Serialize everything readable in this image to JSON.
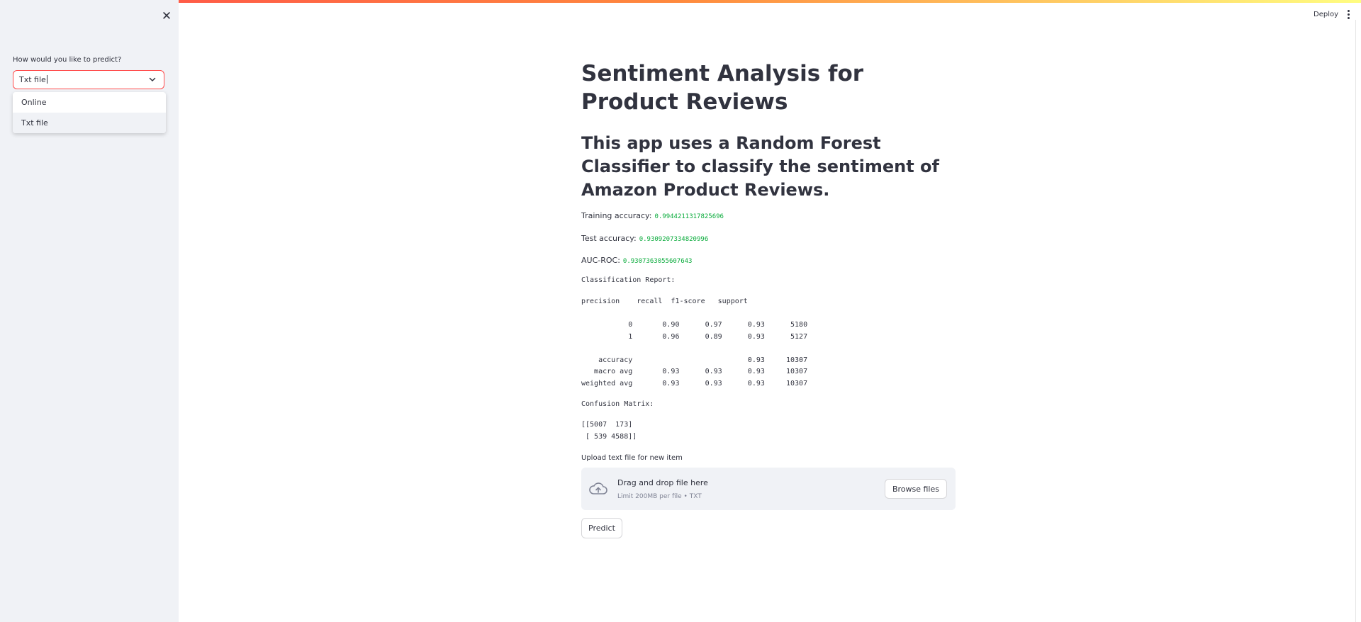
{
  "theme": {
    "accent": "#ff4b4b",
    "sidebar_bg": "#f0f2f6",
    "metric_value_color": "#09ab3b",
    "text_color": "#31333f"
  },
  "header": {
    "deploy_label": "Deploy",
    "menu_icon": "kebab-menu-icon"
  },
  "sidebar": {
    "close_icon": "close-icon",
    "predict_mode_label": "How would you like to predict?",
    "select": {
      "value": "Txt file",
      "options": [
        "Online",
        "Txt file"
      ],
      "selected": "Txt file"
    }
  },
  "main": {
    "title": "Sentiment Analysis for Product Reviews",
    "subtitle": "This app uses a Random Forest Classifier to classify the sentiment of Amazon Product Reviews.",
    "metrics": {
      "training_label": "Training accuracy:",
      "training_value": "0.9944211317825696",
      "test_label": "Test accuracy:",
      "test_value": "0.9309207334820996",
      "auc_label": "AUC-ROC:",
      "auc_value": "0.9307363055607643"
    },
    "classification_report_label": "Classification Report:",
    "classification_report": "precision    recall  f1-score   support\n\n           0       0.90      0.97      0.93      5180\n           1       0.96      0.89      0.93      5127\n\n    accuracy                           0.93     10307\n   macro avg       0.93      0.93      0.93     10307\nweighted avg       0.93      0.93      0.93     10307",
    "confusion_matrix_label": "Confusion Matrix:",
    "confusion_matrix": "[[5007  173]\n [ 539 4588]]",
    "uploader": {
      "label": "Upload text file for new item",
      "title": "Drag and drop file here",
      "limit": "Limit 200MB per file • TXT",
      "browse_label": "Browse files",
      "icon": "cloud-upload-icon"
    },
    "predict_label": "Predict"
  }
}
